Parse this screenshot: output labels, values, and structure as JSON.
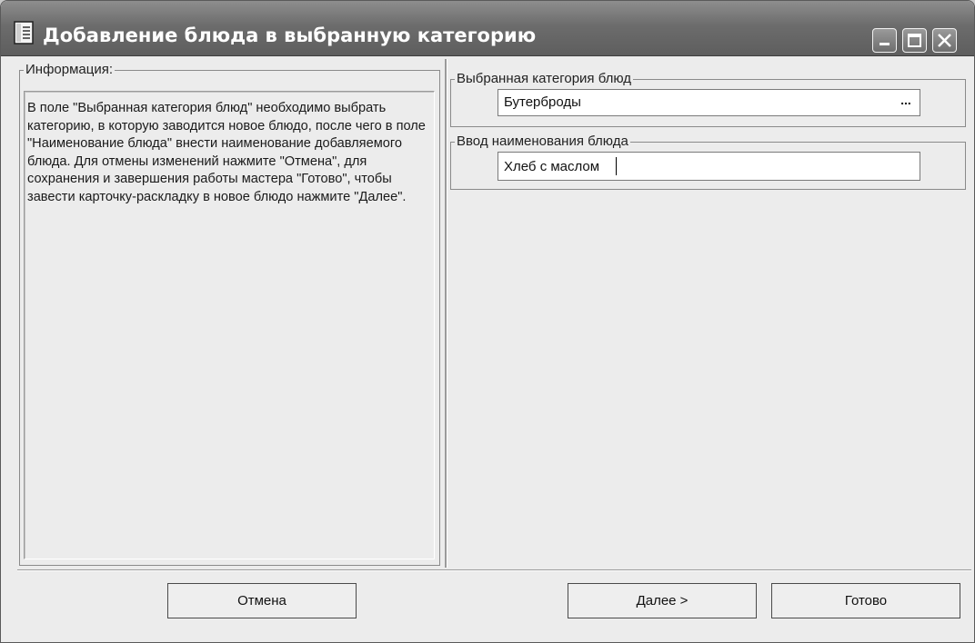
{
  "window": {
    "title": "Добавление блюда в выбранную категорию",
    "icon": "document-icon",
    "controls": [
      "minimize-icon",
      "maximize-icon",
      "close-icon"
    ]
  },
  "info": {
    "legend": "Информация:",
    "text": "В поле \"Выбранная категория блюд\" необходимо выбрать категорию, в которую заводится новое блюдо, после чего в поле \"Наименование блюда\" внести наименование добавляемого блюда. Для отмены изменений нажмите \"Отмена\", для сохранения и завершения работы мастера \"Готово\", чтобы завести карточку-раскладку в новое блюдо нажмите \"Далее\"."
  },
  "category": {
    "legend": "Выбранная категория блюд",
    "value": "Бутерброды",
    "browse_label": "..."
  },
  "dish_name": {
    "legend": "Ввод наименования блюда",
    "value": "Хлеб с маслом"
  },
  "buttons": {
    "cancel": "Отмена",
    "next": "Далее >",
    "done": "Готово"
  }
}
